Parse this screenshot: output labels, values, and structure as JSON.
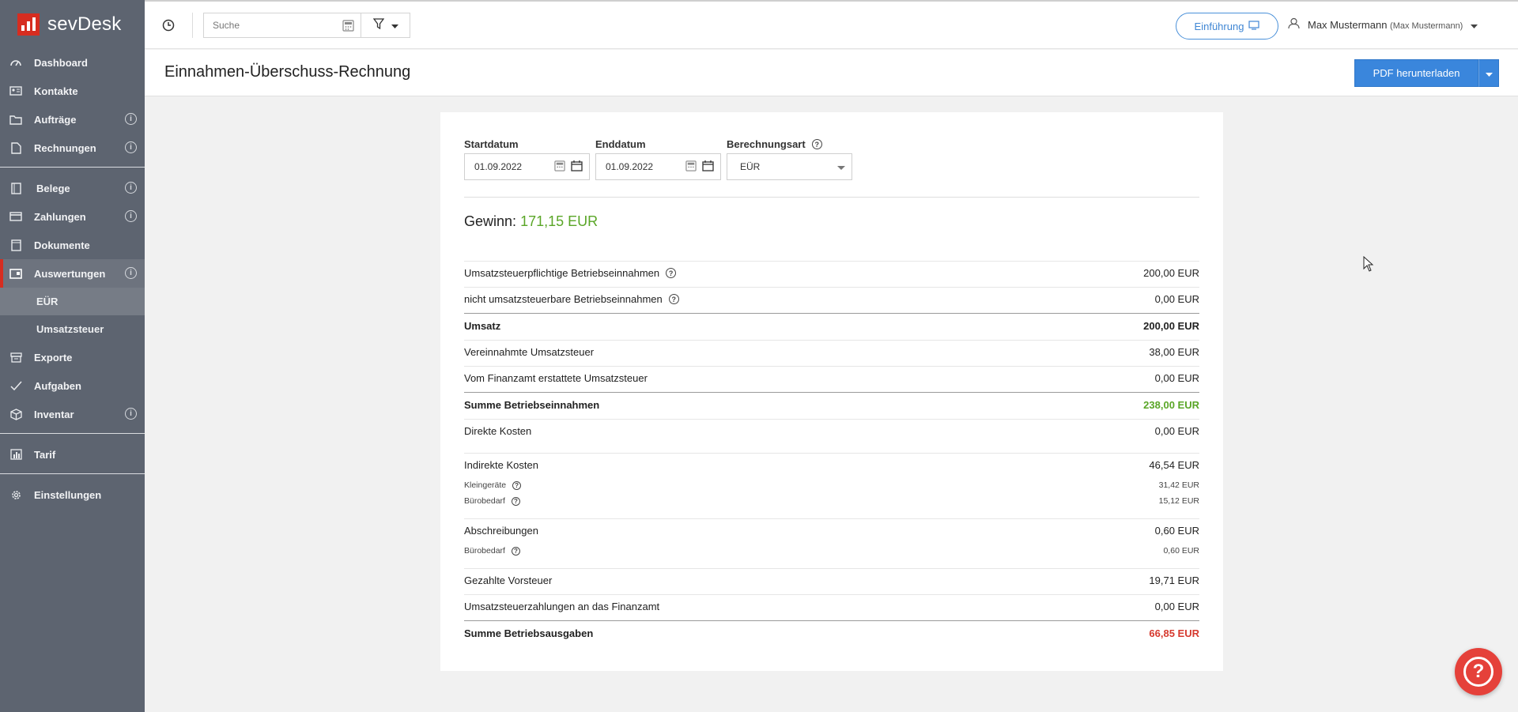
{
  "app": {
    "name": "sevDesk"
  },
  "colors": {
    "brand_red": "#d62d20",
    "accent_blue": "#3a86dc",
    "positive_green": "#5aa627",
    "negative_red": "#d63a2f",
    "sidebar_bg": "#5d6470"
  },
  "sidebar": {
    "items": [
      {
        "label": "Dashboard",
        "icon": "dashboard-icon"
      },
      {
        "label": "Kontakte",
        "icon": "contacts-icon"
      },
      {
        "label": "Aufträge",
        "icon": "folder-icon"
      },
      {
        "label": "Rechnungen",
        "icon": "document-icon"
      },
      {
        "label": "Belege",
        "icon": "receipt-icon"
      },
      {
        "label": "Zahlungen",
        "icon": "card-icon"
      },
      {
        "label": "Dokumente",
        "icon": "file-icon"
      },
      {
        "label": "Auswertungen",
        "icon": "reports-icon"
      },
      {
        "label": "Exporte",
        "icon": "export-icon"
      },
      {
        "label": "Aufgaben",
        "icon": "check-icon"
      },
      {
        "label": "Inventar",
        "icon": "box-icon"
      },
      {
        "label": "Tarif",
        "icon": "chart-icon"
      },
      {
        "label": "Einstellungen",
        "icon": "gear-icon"
      }
    ],
    "subitems": [
      {
        "label": "EÜR"
      },
      {
        "label": "Umsatzsteuer"
      }
    ],
    "info_glyph": "i"
  },
  "topbar": {
    "search_placeholder": "Suche",
    "intro_label": "Einführung",
    "user_name": "Max Mustermann",
    "user_detail": "(Max Mustermann)"
  },
  "page": {
    "title": "Einnahmen-Überschuss-Rechnung",
    "pdf_button": "PDF herunterladen"
  },
  "form": {
    "start_label": "Startdatum",
    "start_value": "01.09.2022",
    "end_label": "Enddatum",
    "end_value": "01.09.2022",
    "method_label": "Berechnungsart",
    "method_value": "EÜR",
    "help_glyph": "?"
  },
  "result": {
    "profit_label": "Gewinn:",
    "profit_value": "171,15 EUR"
  },
  "rows": [
    {
      "label": "Umsatzsteuerpflichtige Betriebseinnahmen",
      "value": "200,00 EUR"
    },
    {
      "label": "nicht umsatzsteuerbare Betriebseinnahmen",
      "value": "0,00 EUR"
    },
    {
      "label": "Umsatz",
      "value": "200,00 EUR"
    },
    {
      "label": "Vereinnahmte Umsatzsteuer",
      "value": "38,00 EUR"
    },
    {
      "label": "Vom Finanzamt erstattete Umsatzsteuer",
      "value": "0,00 EUR"
    },
    {
      "label": "Summe Betriebseinnahmen",
      "value": "238,00 EUR"
    },
    {
      "label": "Direkte Kosten",
      "value": "0,00 EUR"
    },
    {
      "label": "Indirekte Kosten",
      "value": "46,54 EUR"
    },
    {
      "label": "Kleingeräte",
      "value": "31,42 EUR"
    },
    {
      "label": "Bürobedarf",
      "value": "15,12 EUR"
    },
    {
      "label": "Abschreibungen",
      "value": "0,60 EUR"
    },
    {
      "label": "Bürobedarf",
      "value": "0,60 EUR"
    },
    {
      "label": "Gezahlte Vorsteuer",
      "value": "19,71 EUR"
    },
    {
      "label": "Umsatzsteuerzahlungen an das Finanzamt",
      "value": "0,00 EUR"
    },
    {
      "label": "Summe Betriebsausgaben",
      "value": "66,85 EUR"
    }
  ],
  "help_fab_glyph": "?"
}
